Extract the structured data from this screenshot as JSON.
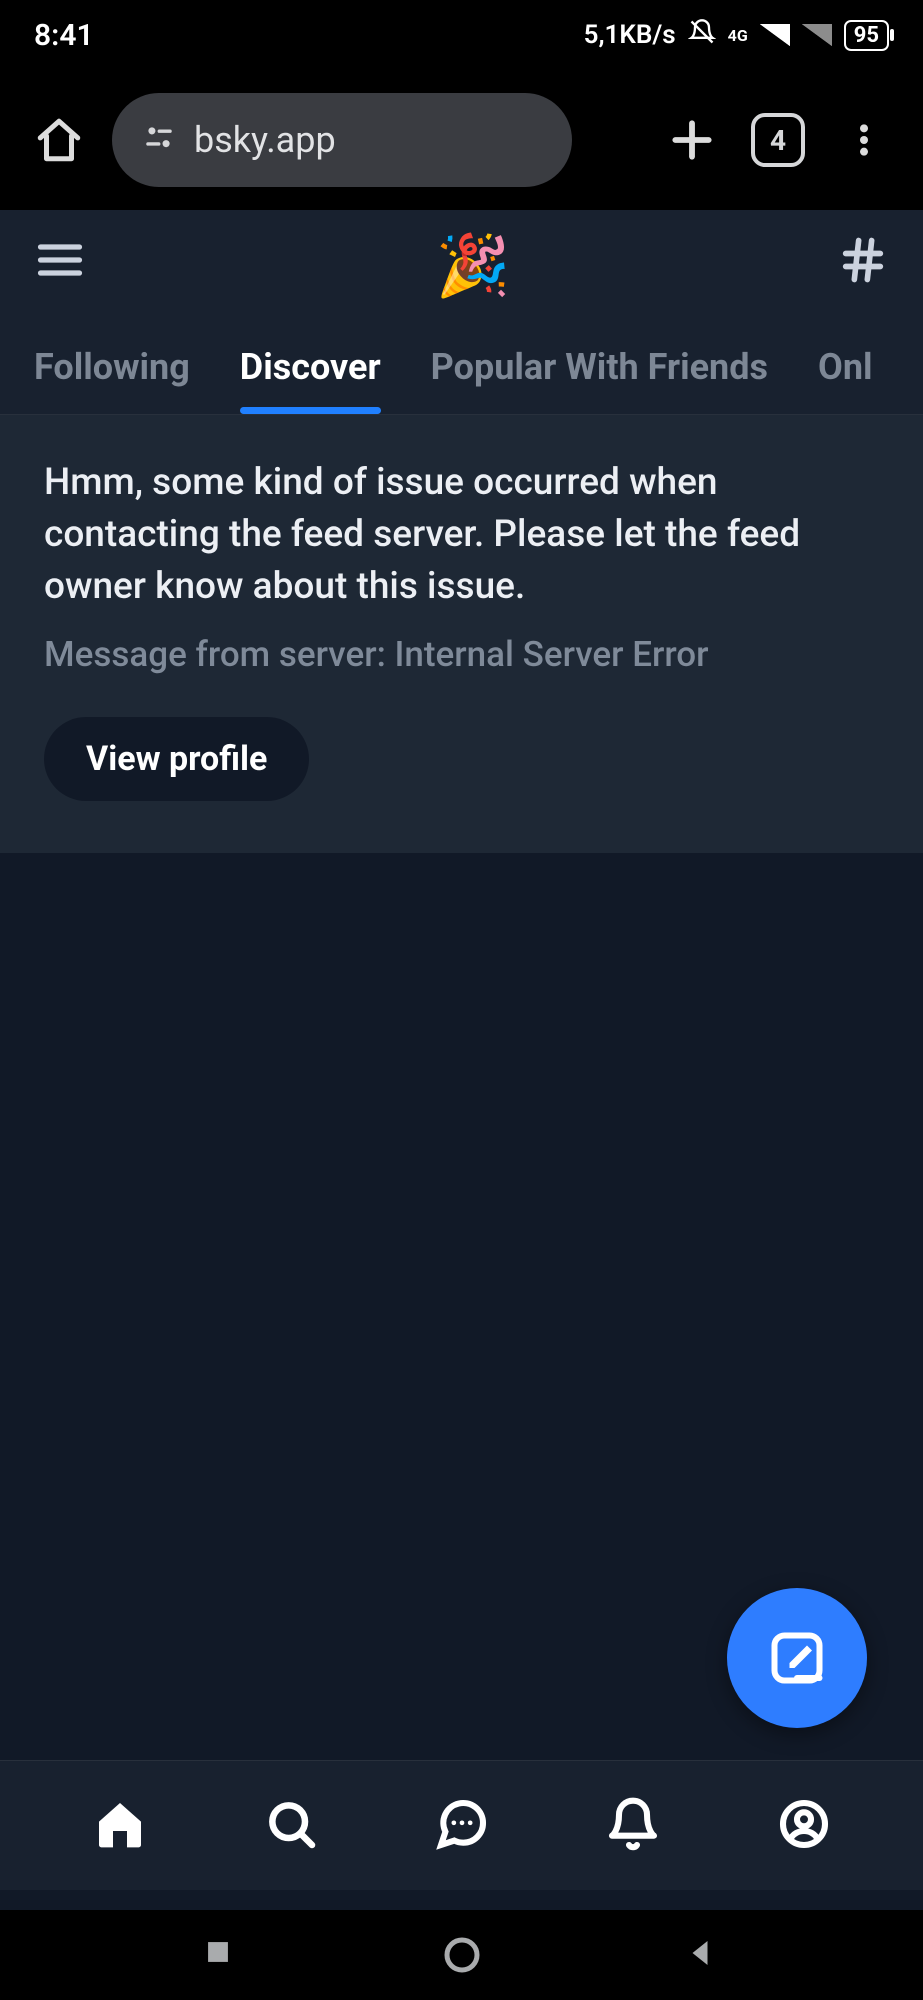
{
  "status_bar": {
    "time": "8:41",
    "net_speed": "5,1KB/s",
    "net_label": "4G",
    "battery": "95"
  },
  "browser": {
    "url": "bsky.app",
    "tab_count": "4"
  },
  "app": {
    "logo_emoji": "🎉"
  },
  "feed_tabs": [
    {
      "label": "Following",
      "active": false
    },
    {
      "label": "Discover",
      "active": true
    },
    {
      "label": "Popular With Friends",
      "active": false
    },
    {
      "label": "Onl",
      "active": false
    }
  ],
  "error": {
    "message": "Hmm, some kind of issue occurred when contacting the feed server. Please let the feed owner know about this issue.",
    "server_message": "Message from server: Internal Server Error",
    "button": "View profile"
  }
}
